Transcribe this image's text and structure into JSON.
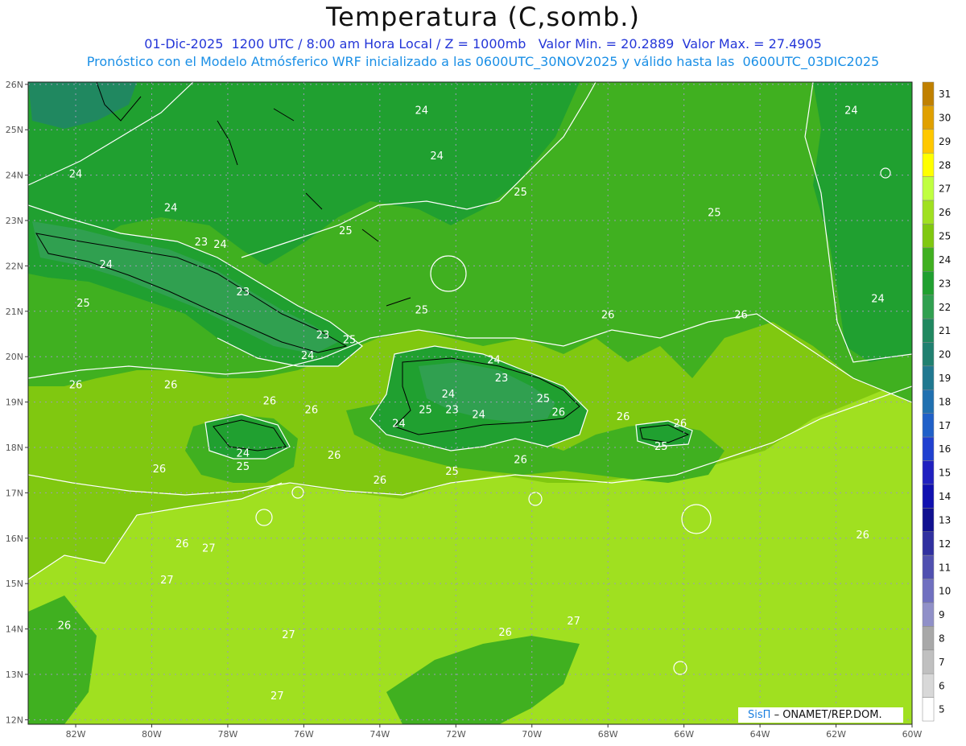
{
  "title": "Temperatura (C,somb.)",
  "subtitle_line1": "01-Dic-2025  1200 UTC / 8:00 am Hora Local / Z = 1000mb   Valor Min. = 20.2889  Valor Max. = 27.4905",
  "subtitle_line2": "Pronóstico con el Modelo Atmósferico WRF inicializado a las 0600UTC_30NOV2025 y válido hasta las  0600UTC_03DIC2025",
  "lat_labels": [
    "26N",
    "25N",
    "24N",
    "23N",
    "22N",
    "21N",
    "20N",
    "19N",
    "18N",
    "17N",
    "16N",
    "15N",
    "14N",
    "13N",
    "12N"
  ],
  "lon_labels": [
    "82W",
    "80W",
    "78W",
    "76W",
    "74W",
    "72W",
    "70W",
    "68W",
    "66W",
    "64W",
    "62W",
    "60W"
  ],
  "colorbar": {
    "levels": [
      "31",
      "30",
      "29",
      "28",
      "27",
      "26",
      "25",
      "24",
      "23",
      "22",
      "21",
      "20",
      "19",
      "18",
      "17",
      "16",
      "15",
      "14",
      "13",
      "12",
      "11",
      "10",
      "9",
      "8",
      "7",
      "6",
      "5"
    ],
    "colors": [
      "#c08000",
      "#e0a000",
      "#ffc800",
      "#ffff00",
      "#c0ff40",
      "#a0e020",
      "#80c810",
      "#40b020",
      "#20a030",
      "#30a050",
      "#208860",
      "#208070",
      "#207890",
      "#2070b0",
      "#2060c8",
      "#2040d0",
      "#2020c0",
      "#1010b0",
      "#101090",
      "#3030a0",
      "#5050b0",
      "#7070c0",
      "#9090c8",
      "#a8a8a8",
      "#c0c0c0",
      "#d8d8d8",
      "#ffffff"
    ]
  },
  "contour_labels": [
    {
      "text": "24",
      "lon": -82.0,
      "lat": 23.95
    },
    {
      "text": "24",
      "lon": -79.5,
      "lat": 23.2
    },
    {
      "text": "24",
      "lon": -81.2,
      "lat": 21.95
    },
    {
      "text": "23",
      "lon": -78.7,
      "lat": 22.45
    },
    {
      "text": "24",
      "lon": -78.2,
      "lat": 22.4
    },
    {
      "text": "23",
      "lon": -77.6,
      "lat": 21.35
    },
    {
      "text": "25",
      "lon": -81.8,
      "lat": 21.1
    },
    {
      "text": "23",
      "lon": -75.5,
      "lat": 20.4
    },
    {
      "text": "24",
      "lon": -75.9,
      "lat": 19.95
    },
    {
      "text": "25",
      "lon": -74.8,
      "lat": 20.3
    },
    {
      "text": "25",
      "lon": -74.9,
      "lat": 22.7
    },
    {
      "text": "24",
      "lon": -72.9,
      "lat": 25.35
    },
    {
      "text": "24",
      "lon": -72.5,
      "lat": 24.35
    },
    {
      "text": "25",
      "lon": -70.3,
      "lat": 23.55
    },
    {
      "text": "24",
      "lon": -68.3,
      "lat": 26.05
    },
    {
      "text": "25",
      "lon": -65.2,
      "lat": 23.1
    },
    {
      "text": "24",
      "lon": -61.6,
      "lat": 25.35
    },
    {
      "text": "24",
      "lon": -60.9,
      "lat": 21.2
    },
    {
      "text": "25",
      "lon": -72.9,
      "lat": 20.95
    },
    {
      "text": "26",
      "lon": -68.0,
      "lat": 20.85
    },
    {
      "text": "26",
      "lon": -64.5,
      "lat": 20.85
    },
    {
      "text": "24",
      "lon": -71.0,
      "lat": 19.85
    },
    {
      "text": "23",
      "lon": -70.8,
      "lat": 19.45
    },
    {
      "text": "24",
      "lon": -72.2,
      "lat": 19.1
    },
    {
      "text": "25",
      "lon": -72.8,
      "lat": 18.75
    },
    {
      "text": "23",
      "lon": -72.1,
      "lat": 18.75
    },
    {
      "text": "24",
      "lon": -71.4,
      "lat": 18.65
    },
    {
      "text": "25",
      "lon": -69.7,
      "lat": 19.0
    },
    {
      "text": "26",
      "lon": -69.3,
      "lat": 18.7
    },
    {
      "text": "24",
      "lon": -73.5,
      "lat": 18.45
    },
    {
      "text": "26",
      "lon": -67.6,
      "lat": 18.6
    },
    {
      "text": "26",
      "lon": -66.1,
      "lat": 18.45
    },
    {
      "text": "25",
      "lon": -66.6,
      "lat": 17.95
    },
    {
      "text": "26",
      "lon": -70.3,
      "lat": 17.65
    },
    {
      "text": "25",
      "lon": -72.1,
      "lat": 17.4
    },
    {
      "text": "26",
      "lon": -82.0,
      "lat": 19.3
    },
    {
      "text": "26",
      "lon": -79.5,
      "lat": 19.3
    },
    {
      "text": "26",
      "lon": -76.9,
      "lat": 18.95
    },
    {
      "text": "26",
      "lon": -75.8,
      "lat": 18.75
    },
    {
      "text": "24",
      "lon": -77.6,
      "lat": 17.8
    },
    {
      "text": "25",
      "lon": -77.6,
      "lat": 17.5
    },
    {
      "text": "26",
      "lon": -79.8,
      "lat": 17.45
    },
    {
      "text": "26",
      "lon": -75.2,
      "lat": 17.75
    },
    {
      "text": "26",
      "lon": -74.0,
      "lat": 17.2
    },
    {
      "text": "26",
      "lon": -79.2,
      "lat": 15.8
    },
    {
      "text": "27",
      "lon": -78.5,
      "lat": 15.7
    },
    {
      "text": "27",
      "lon": -79.6,
      "lat": 15.0
    },
    {
      "text": "26",
      "lon": -82.3,
      "lat": 14.0
    },
    {
      "text": "27",
      "lon": -76.4,
      "lat": 13.8
    },
    {
      "text": "26",
      "lon": -70.7,
      "lat": 13.85
    },
    {
      "text": "27",
      "lon": -68.9,
      "lat": 14.1
    },
    {
      "text": "27",
      "lon": -76.7,
      "lat": 12.45
    },
    {
      "text": "26",
      "lon": -61.3,
      "lat": 16.0
    }
  ],
  "credit": {
    "brand": "SisΠ",
    "text": "– ONAMET/REP.DOM."
  }
}
